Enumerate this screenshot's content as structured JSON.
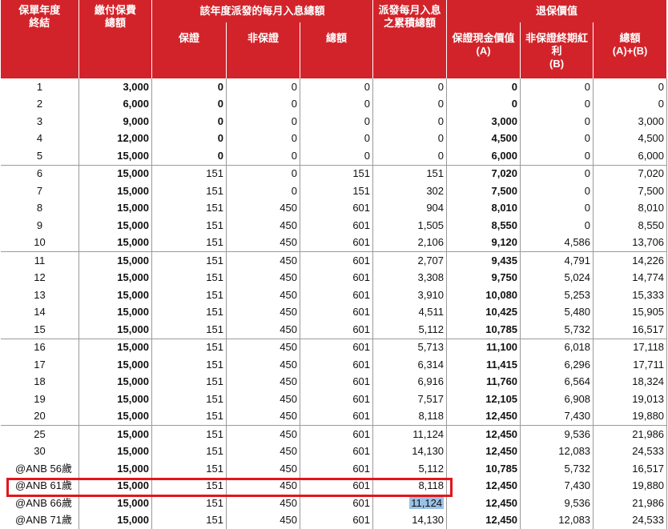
{
  "header": {
    "policy_year_end": "保單年度\n終結",
    "total_premium": "繳付保費\n總額",
    "monthly_income_group": "該年度派發的每月入息總額",
    "guaranteed": "保證",
    "non_guaranteed": "非保證",
    "total": "總額",
    "accumulated_income": "派發每月入息\n之累積總額",
    "surrender_group": "退保價值",
    "guaranteed_cash_value": "保證現金價值\n(A)",
    "terminal_bonus": "非保證終期紅利\n(B)",
    "surrender_total": "總額\n(A)+(B)"
  },
  "rows": [
    [
      "1",
      "3,000",
      "0",
      "0",
      "0",
      "0",
      "0",
      "0",
      "0"
    ],
    [
      "2",
      "6,000",
      "0",
      "0",
      "0",
      "0",
      "0",
      "0",
      "0"
    ],
    [
      "3",
      "9,000",
      "0",
      "0",
      "0",
      "0",
      "3,000",
      "0",
      "3,000"
    ],
    [
      "4",
      "12,000",
      "0",
      "0",
      "0",
      "0",
      "4,500",
      "0",
      "4,500"
    ],
    [
      "5",
      "15,000",
      "0",
      "0",
      "0",
      "0",
      "6,000",
      "0",
      "6,000"
    ],
    [
      "6",
      "15,000",
      "151",
      "0",
      "151",
      "151",
      "7,020",
      "0",
      "7,020"
    ],
    [
      "7",
      "15,000",
      "151",
      "0",
      "151",
      "302",
      "7,500",
      "0",
      "7,500"
    ],
    [
      "8",
      "15,000",
      "151",
      "450",
      "601",
      "904",
      "8,010",
      "0",
      "8,010"
    ],
    [
      "9",
      "15,000",
      "151",
      "450",
      "601",
      "1,505",
      "8,550",
      "0",
      "8,550"
    ],
    [
      "10",
      "15,000",
      "151",
      "450",
      "601",
      "2,106",
      "9,120",
      "4,586",
      "13,706"
    ],
    [
      "11",
      "15,000",
      "151",
      "450",
      "601",
      "2,707",
      "9,435",
      "4,791",
      "14,226"
    ],
    [
      "12",
      "15,000",
      "151",
      "450",
      "601",
      "3,308",
      "9,750",
      "5,024",
      "14,774"
    ],
    [
      "13",
      "15,000",
      "151",
      "450",
      "601",
      "3,910",
      "10,080",
      "5,253",
      "15,333"
    ],
    [
      "14",
      "15,000",
      "151",
      "450",
      "601",
      "4,511",
      "10,425",
      "5,480",
      "15,905"
    ],
    [
      "15",
      "15,000",
      "151",
      "450",
      "601",
      "5,112",
      "10,785",
      "5,732",
      "16,517"
    ],
    [
      "16",
      "15,000",
      "151",
      "450",
      "601",
      "5,713",
      "11,100",
      "6,018",
      "17,118"
    ],
    [
      "17",
      "15,000",
      "151",
      "450",
      "601",
      "6,314",
      "11,415",
      "6,296",
      "17,711"
    ],
    [
      "18",
      "15,000",
      "151",
      "450",
      "601",
      "6,916",
      "11,760",
      "6,564",
      "18,324"
    ],
    [
      "19",
      "15,000",
      "151",
      "450",
      "601",
      "7,517",
      "12,105",
      "6,908",
      "19,013"
    ],
    [
      "20",
      "15,000",
      "151",
      "450",
      "601",
      "8,118",
      "12,450",
      "7,430",
      "19,880"
    ],
    [
      "25",
      "15,000",
      "151",
      "450",
      "601",
      "11,124",
      "12,450",
      "9,536",
      "21,986"
    ],
    [
      "30",
      "15,000",
      "151",
      "450",
      "601",
      "14,130",
      "12,450",
      "12,083",
      "24,533"
    ],
    [
      "@ANB 56歲",
      "15,000",
      "151",
      "450",
      "601",
      "5,112",
      "10,785",
      "5,732",
      "16,517"
    ],
    [
      "@ANB 61歲",
      "15,000",
      "151",
      "450",
      "601",
      "8,118",
      "12,450",
      "7,430",
      "19,880"
    ],
    [
      "@ANB 66歲",
      "15,000",
      "151",
      "450",
      "601",
      "11,124",
      "12,450",
      "9,536",
      "21,986"
    ],
    [
      "@ANB 71歲",
      "15,000",
      "151",
      "450",
      "601",
      "14,130",
      "12,450",
      "12,083",
      "24,533"
    ]
  ],
  "colors": {
    "header_bg": "#d2232a",
    "highlight_box": "#e3151c",
    "selection": "#9bc2e6"
  }
}
